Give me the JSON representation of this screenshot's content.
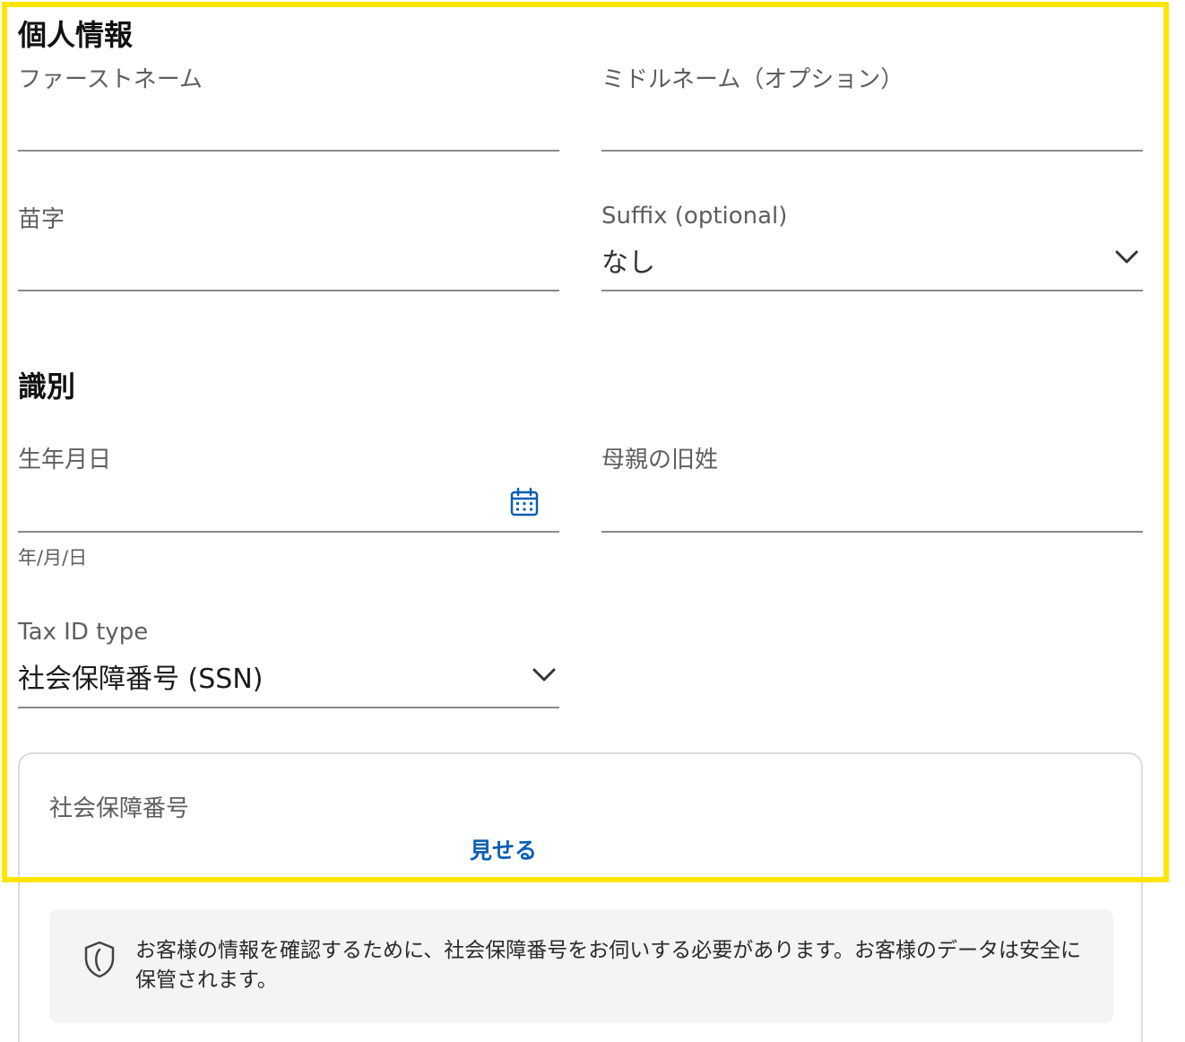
{
  "personal_info": {
    "title": "個人情報",
    "first_name": {
      "label": "ファーストネーム",
      "value": ""
    },
    "middle_name": {
      "label": "ミドルネーム（オプション）",
      "value": ""
    },
    "last_name": {
      "label": "苗字",
      "value": ""
    },
    "suffix": {
      "label": "Suffix (optional)",
      "selected": "なし"
    }
  },
  "identification": {
    "title": "識別",
    "dob": {
      "label": "生年月日",
      "value": "",
      "helper": "年/月/日"
    },
    "maiden_name": {
      "label": "母親の旧姓",
      "value": ""
    },
    "tax_id_type": {
      "label": "Tax ID type",
      "selected": "社会保障番号 (SSN)"
    }
  },
  "ssn": {
    "label": "社会保障番号",
    "show_label": "見せる",
    "notice": "お客様の情報を確認するために、社会保障番号をお伺いする必要があります。お客様のデータは安全に保管されます。"
  },
  "colors": {
    "highlight": "#ffe600",
    "link": "#0b5fb3",
    "notice_bg": "#f3f4f6"
  },
  "icons": {
    "calendar": "calendar-icon",
    "chevron": "chevron-down-icon",
    "shield": "shield-icon"
  }
}
